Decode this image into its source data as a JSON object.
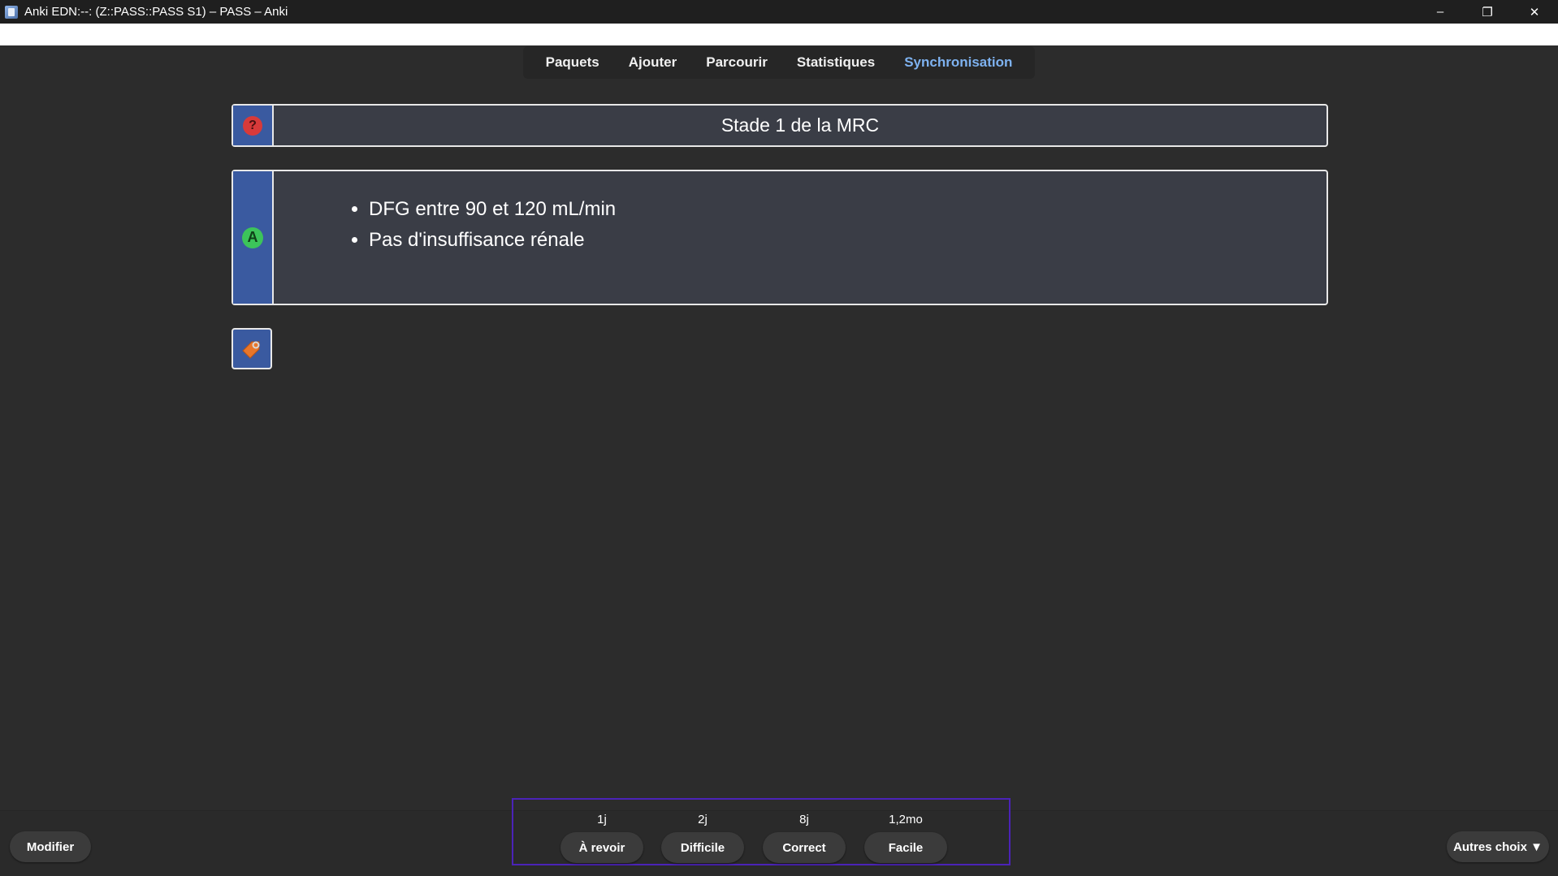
{
  "window": {
    "title": "Anki EDN:--: (Z::PASS::PASS S1) – PASS – Anki",
    "controls": [
      "–",
      "❐",
      "✕"
    ]
  },
  "toolbar": {
    "items": [
      {
        "label": "Paquets"
      },
      {
        "label": "Ajouter"
      },
      {
        "label": "Parcourir"
      },
      {
        "label": "Statistiques"
      },
      {
        "label": "Synchronisation",
        "active": true
      }
    ],
    "active_color": "#7eb2f0"
  },
  "card": {
    "question": "Stade 1 de la MRC",
    "question_icon": "question-icon",
    "answer_icon": "answer-icon",
    "answer_items": [
      "DFG entre 90 et 120 mL/min",
      "Pas d'insuffisance rénale"
    ],
    "tag_icon": "tag-icon",
    "side_color": "#3a5aa0"
  },
  "bottom": {
    "edit_label": "Modifier",
    "more_label": "Autres choix ▼",
    "answers": [
      {
        "interval": "1j",
        "label": "À revoir"
      },
      {
        "interval": "2j",
        "label": "Difficile"
      },
      {
        "interval": "8j",
        "label": "Correct"
      },
      {
        "interval": "1,2mo",
        "label": "Facile"
      }
    ],
    "highlight_color": "#4b23b8"
  }
}
